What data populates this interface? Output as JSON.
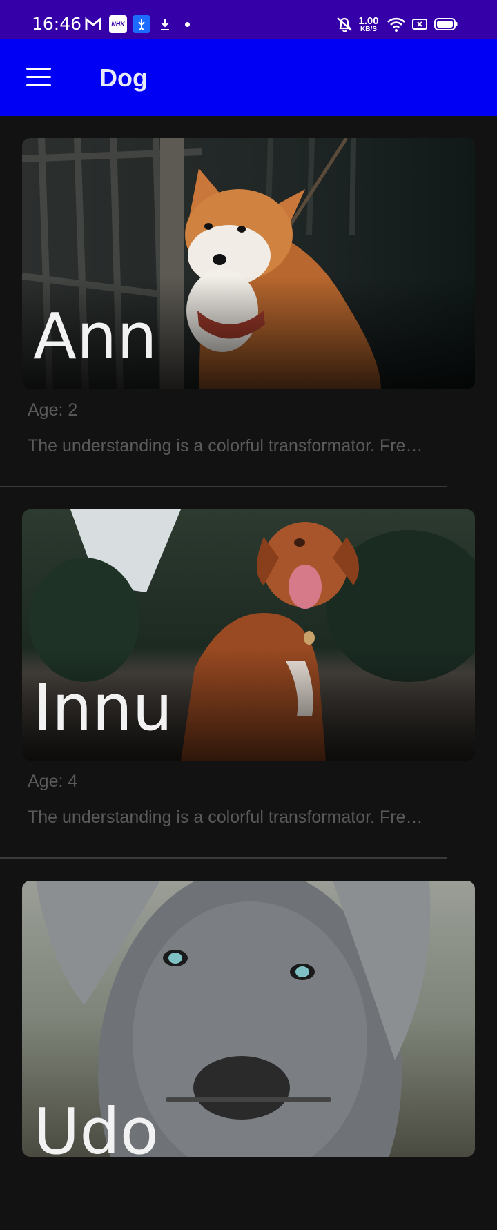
{
  "status_bar": {
    "time": "16:46",
    "speed_value": "1.00",
    "speed_unit": "KB/S",
    "nhk_badge": "NHK",
    "icons": [
      "gmail-icon",
      "nhk-app-icon",
      "usb-debug-icon",
      "download-icon",
      "dot-icon",
      "mute-icon",
      "wifi-icon",
      "no-sim-icon",
      "battery-icon"
    ]
  },
  "app_bar": {
    "title": "Dog",
    "menu_icon": "hamburger-menu-icon"
  },
  "dogs": [
    {
      "name": "Ann",
      "age": "Age: 2",
      "description": "The understanding is a colorful transformator. Fre…"
    },
    {
      "name": "Innu",
      "age": "Age: 4",
      "description": "The understanding is a colorful transformator. Fre…"
    },
    {
      "name": "Udo",
      "age": "",
      "description": ""
    }
  ],
  "colors": {
    "status_bar": "#3500a8",
    "app_bar": "#0000f5",
    "background": "#121212"
  }
}
